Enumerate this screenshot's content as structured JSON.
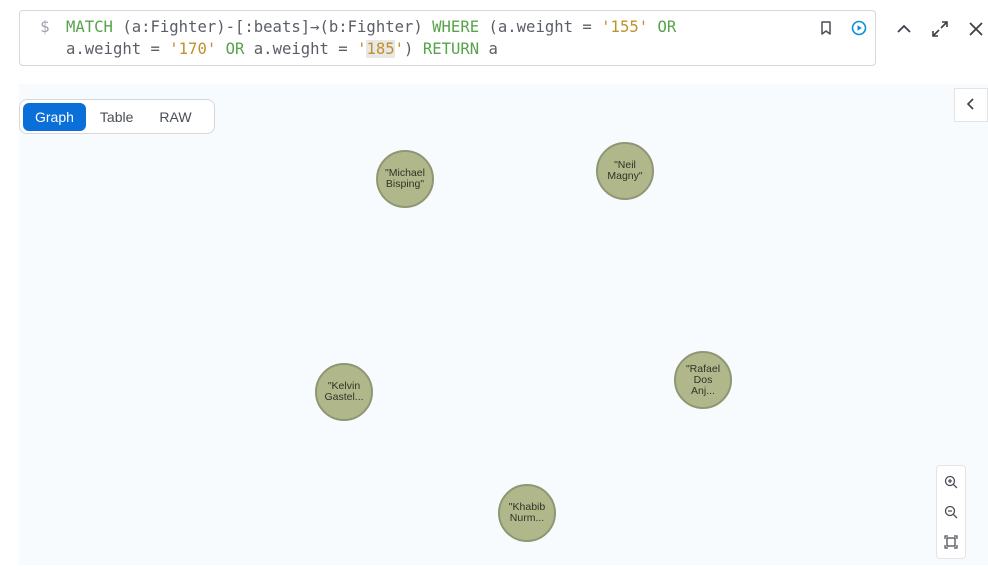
{
  "query": {
    "prompt": "$",
    "tokens": [
      {
        "t": "MATCH",
        "c": "kw"
      },
      {
        "t": " (a:Fighter)-[:beats]→(b:Fighter) ",
        "c": ""
      },
      {
        "t": "WHERE",
        "c": "kw"
      },
      {
        "t": " (a.weight = ",
        "c": ""
      },
      {
        "t": "'155'",
        "c": "str"
      },
      {
        "t": " ",
        "c": ""
      },
      {
        "t": "OR",
        "c": "kw"
      },
      {
        "t": "\n",
        "c": ""
      },
      {
        "t": "a.weight = ",
        "c": ""
      },
      {
        "t": "'170'",
        "c": "str"
      },
      {
        "t": " ",
        "c": ""
      },
      {
        "t": "OR",
        "c": "kw"
      },
      {
        "t": " a.weight = ",
        "c": ""
      },
      {
        "t": "'",
        "c": "str"
      },
      {
        "t": "185",
        "c": "str hl"
      },
      {
        "t": "'",
        "c": "str"
      },
      {
        "t": ") ",
        "c": ""
      },
      {
        "t": "RETURN",
        "c": "kw"
      },
      {
        "t": " a",
        "c": ""
      }
    ]
  },
  "icons": {
    "bookmark": "bookmark-icon",
    "run": "run-icon",
    "collapse_up": "chevron-up-icon",
    "expand": "expand-icon",
    "close": "close-icon",
    "panel": "chevron-left-icon",
    "zoom_in": "zoom-in-icon",
    "zoom_out": "zoom-out-icon",
    "fit": "fit-to-screen-icon"
  },
  "tabs": [
    {
      "label": "Graph",
      "active": true
    },
    {
      "label": "Table",
      "active": false
    },
    {
      "label": "RAW",
      "active": false
    }
  ],
  "nodes": [
    {
      "label": "\"Michael\nBisping\""
    },
    {
      "label": "\"Neil\nMagny\""
    },
    {
      "label": "\"Kelvin\nGastel..."
    },
    {
      "label": "\"Rafael\nDos\nAnj..."
    },
    {
      "label": "\"Khabib\nNurm..."
    }
  ],
  "colors": {
    "node_fill": "#b0b88b",
    "node_border": "#8e9673",
    "active_tab": "#0a6fd8",
    "keyword": "#57a34b",
    "string": "#c0902a",
    "run_icon": "#0a8fd8"
  }
}
